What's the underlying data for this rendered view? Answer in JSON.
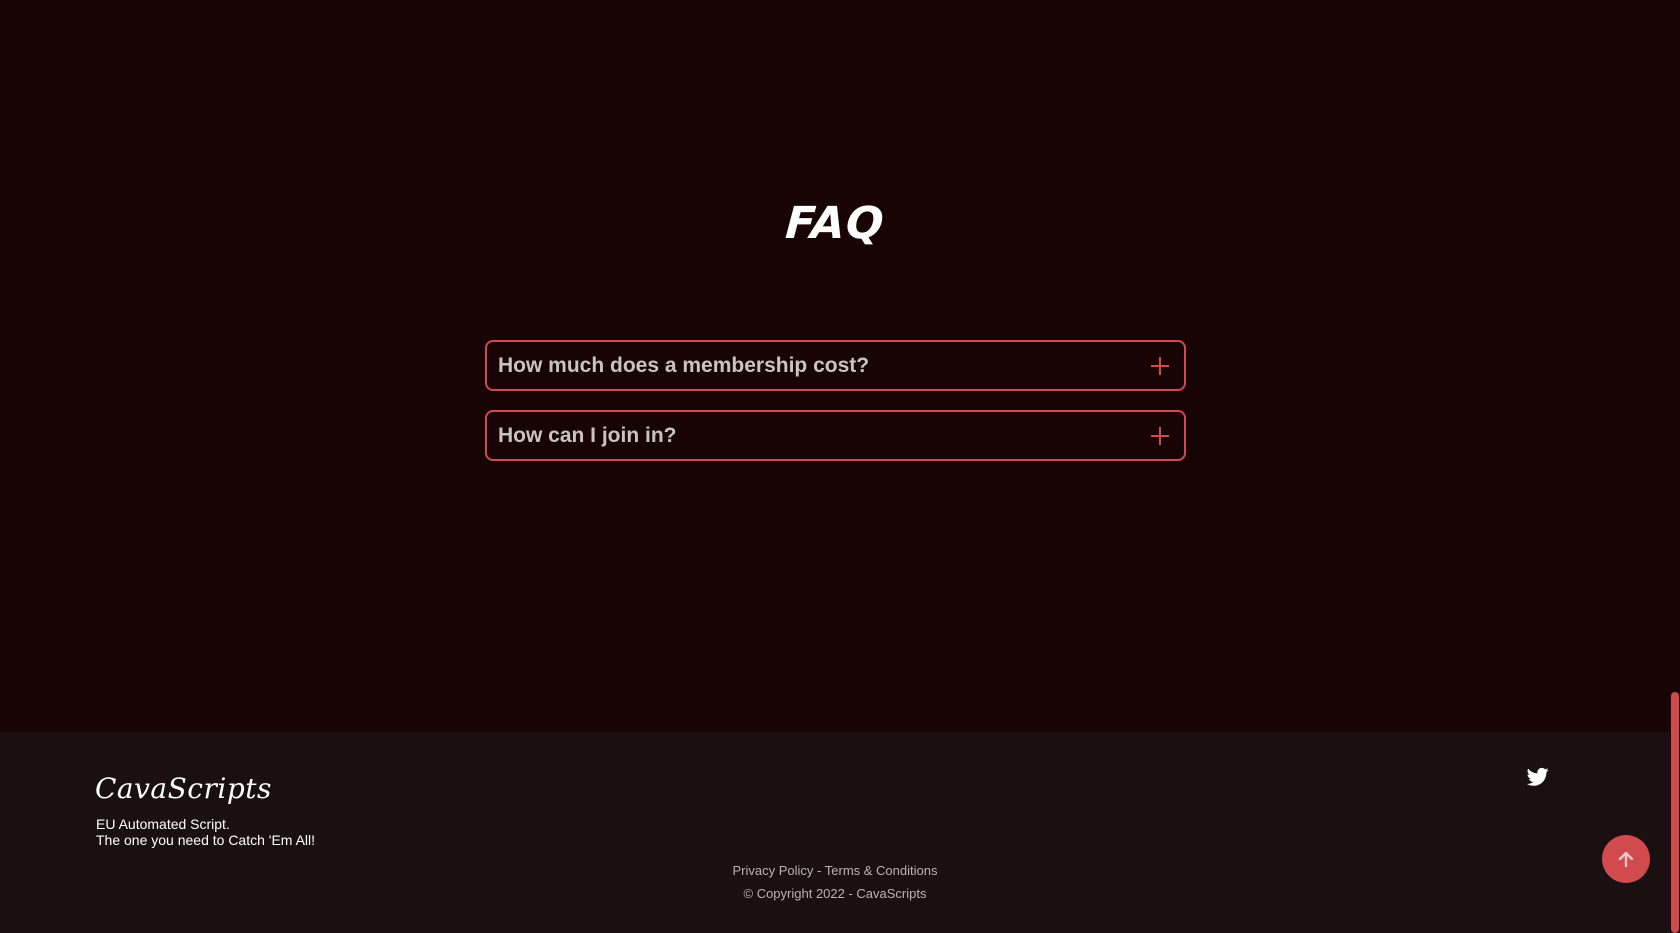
{
  "faq": {
    "title": "FAQ",
    "items": [
      {
        "question": "How much does a membership cost?"
      },
      {
        "question": "How can I join in?"
      }
    ]
  },
  "footer": {
    "brand": "CavaScripts",
    "tagline_line1": "EU Automated Script.",
    "tagline_line2": "The one you need to Catch 'Em All!",
    "privacy_label": "Privacy Policy",
    "separator": " - ",
    "terms_label": "Terms & Conditions",
    "copyright": "© Copyright 2022 - CavaScripts"
  },
  "icons": {
    "faq_toggle": "plus-icon",
    "social": "twitter-icon",
    "back_to_top": "arrow-up-icon"
  },
  "colors": {
    "background": "#190405",
    "footer_background": "#1a1011",
    "accent": "#d04a4e",
    "question_text": "#c9c4c4"
  }
}
